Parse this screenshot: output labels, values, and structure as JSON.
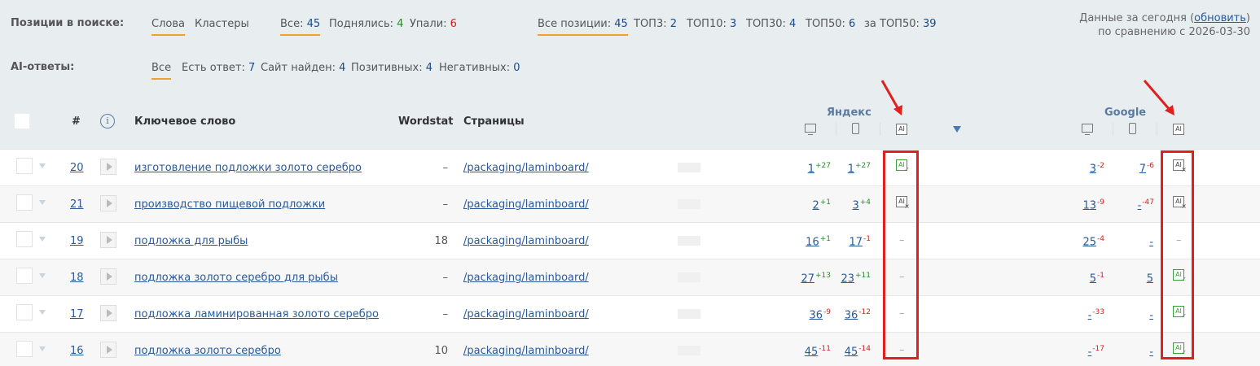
{
  "filters": {
    "search_label": "Позиции в поиске:",
    "words": "Слова",
    "clusters": "Кластеры",
    "all_label": "Все:",
    "all_val": "45",
    "up_label": "Поднялись:",
    "up_val": "4",
    "down_label": "Упали:",
    "down_val": "6",
    "allpos_label": "Все позиции:",
    "allpos_val": "45",
    "top3_label": "ТОП3:",
    "top3_val": "2",
    "top10_label": "ТОП10:",
    "top10_val": "3",
    "top30_label": "ТОП30:",
    "top30_val": "4",
    "top50_label": "ТОП50:",
    "top50_val": "6",
    "over50_label": "за ТОП50:",
    "over50_val": "39",
    "ai_label": "AI-ответы:",
    "ai_all": "Все",
    "has_answer_label": "Есть ответ:",
    "has_answer_val": "7",
    "site_found_label": "Сайт найден:",
    "site_found_val": "4",
    "positive_label": "Позитивных:",
    "positive_val": "4",
    "negative_label": "Негативных:",
    "negative_val": "0"
  },
  "info": {
    "line1_prefix": "Данные за сегодня (",
    "refresh": "обновить",
    "line1_suffix": ")",
    "line2": "по сравнению с 2026-03-30"
  },
  "header": {
    "hash": "#",
    "keyword": "Ключевое слово",
    "wordstat": "Wordstat",
    "pages": "Страницы",
    "yandex": "Яндекс",
    "google": "Google",
    "ai": "AI",
    "info_glyph": "i"
  },
  "dash": "–",
  "rows": [
    {
      "id": "20",
      "keyword": "изготовление подложки золото серебро",
      "wordstat": "–",
      "page": "/packaging/laminboard/",
      "y_desktop": "1",
      "y_desktop_ch": "+27",
      "y_mobile": "1",
      "y_mobile_ch": "+27",
      "y_ai": "ok",
      "g_desktop": "3",
      "g_desktop_ch": "-2",
      "g_mobile": "7",
      "g_mobile_ch": "-6",
      "g_ai": "x"
    },
    {
      "id": "21",
      "keyword": "производство пищевой подложки",
      "wordstat": "–",
      "page": "/packaging/laminboard/",
      "y_desktop": "2",
      "y_desktop_ch": "+1",
      "y_mobile": "3",
      "y_mobile_ch": "+4",
      "y_ai": "x",
      "g_desktop": "13",
      "g_desktop_ch": "-9",
      "g_mobile": "-",
      "g_mobile_ch": "-47",
      "g_ai": "x"
    },
    {
      "id": "19",
      "keyword": "подложка для рыбы",
      "wordstat": "18",
      "page": "/packaging/laminboard/",
      "y_desktop": "16",
      "y_desktop_ch": "+1",
      "y_mobile": "17",
      "y_mobile_ch": "-1",
      "y_ai": "none",
      "g_desktop": "25",
      "g_desktop_ch": "-4",
      "g_mobile": "-",
      "g_mobile_ch": "",
      "g_ai": "none"
    },
    {
      "id": "18",
      "keyword": "подложка золото серебро для рыбы",
      "wordstat": "–",
      "page": "/packaging/laminboard/",
      "y_desktop": "27",
      "y_desktop_ch": "+13",
      "y_mobile": "23",
      "y_mobile_ch": "+11",
      "y_ai": "none",
      "g_desktop": "5",
      "g_desktop_ch": "-1",
      "g_mobile": "5",
      "g_mobile_ch": "",
      "g_ai": "ok"
    },
    {
      "id": "17",
      "keyword": "подложка ламинированная золото серебро",
      "wordstat": "–",
      "page": "/packaging/laminboard/",
      "y_desktop": "36",
      "y_desktop_ch": "-9",
      "y_mobile": "36",
      "y_mobile_ch": "-12",
      "y_ai": "none",
      "g_desktop": "-",
      "g_desktop_ch": "-33",
      "g_mobile": "-",
      "g_mobile_ch": "",
      "g_ai": "ok"
    },
    {
      "id": "16",
      "keyword": "подложка золото серебро",
      "wordstat": "10",
      "page": "/packaging/laminboard/",
      "y_desktop": "45",
      "y_desktop_ch": "-11",
      "y_mobile": "45",
      "y_mobile_ch": "-14",
      "y_ai": "none",
      "g_desktop": "-",
      "g_desktop_ch": "-17",
      "g_mobile": "-",
      "g_mobile_ch": "",
      "g_ai": "ok"
    }
  ],
  "colors": {
    "accent": "#f0a030",
    "link": "#2a5a9a",
    "up": "#2b8a2b",
    "down": "#d02020",
    "highlight": "#e02020"
  },
  "icons": [
    "monitor-icon",
    "phone-icon",
    "ai-icon",
    "ai-ok-icon",
    "ai-x-icon",
    "play-icon",
    "info-icon",
    "sort-down-icon",
    "red-arrow-icon"
  ]
}
